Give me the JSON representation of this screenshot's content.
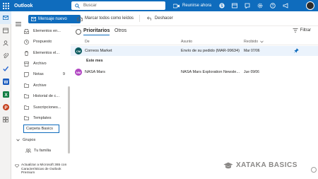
{
  "topbar": {
    "app_name": "Outlook",
    "search_placeholder": "Buscar",
    "meet_now": "Reunirse ahora",
    "icons": [
      "skype-icon",
      "calendar-share-icon",
      "whatsnew-icon",
      "settings-icon",
      "help-icon",
      "megaphone-icon"
    ]
  },
  "folder_pane": {
    "new_mail": "Mensaje nuevo",
    "folders": [
      {
        "label": "Elementos en...",
        "icon": "inbox-icon",
        "count": ""
      },
      {
        "label": "Pospuesto",
        "icon": "clock-icon",
        "count": ""
      },
      {
        "label": "Elementos el...",
        "icon": "trash-icon",
        "count": ""
      },
      {
        "label": "Archivo",
        "icon": "archive-icon",
        "count": ""
      },
      {
        "label": "Notas",
        "icon": "note-icon",
        "count": "9"
      },
      {
        "label": "Archive",
        "icon": "folder-icon",
        "count": ""
      },
      {
        "label": "Historial de c...",
        "icon": "folder-icon",
        "count": ""
      },
      {
        "label": "Suscripciones...",
        "icon": "folder-icon",
        "count": ""
      },
      {
        "label": "Templates",
        "icon": "folder-icon",
        "count": ""
      }
    ],
    "new_folder_value": "Carpeta Basics",
    "groups_label": "Grupos",
    "family_label": "Tu familia",
    "update_text": "Actualizar a Microsoft 365 con Características de Outlook Premium"
  },
  "command_bar": {
    "mark_all_read": "Marcar todos como leídos",
    "undo": "Deshacer"
  },
  "message_list": {
    "tabs": [
      "Prioritarios",
      "Otros"
    ],
    "filter": "Filtrar",
    "columns": {
      "from": "De",
      "subject": "Asunto",
      "received": "Recibido"
    },
    "pinned": [
      {
        "initials": "CM",
        "from": "Correos Market",
        "subject": "Envío de su pedido (MAR-99634)",
        "date": "Mar 07/06",
        "avatar_color": "#0b5a5e"
      }
    ],
    "group_label": "Este mes",
    "messages": [
      {
        "initials": "NM",
        "from": "NASA Mars",
        "subject": "NASA Mars Exploration Newsle...",
        "date": "Jue 09/06",
        "avatar_color": "#b146c2"
      }
    ]
  },
  "watermark": "XATAKA BASICS",
  "colors": {
    "brand": "#0f6cbd",
    "selected_row": "#ebf3fc"
  }
}
